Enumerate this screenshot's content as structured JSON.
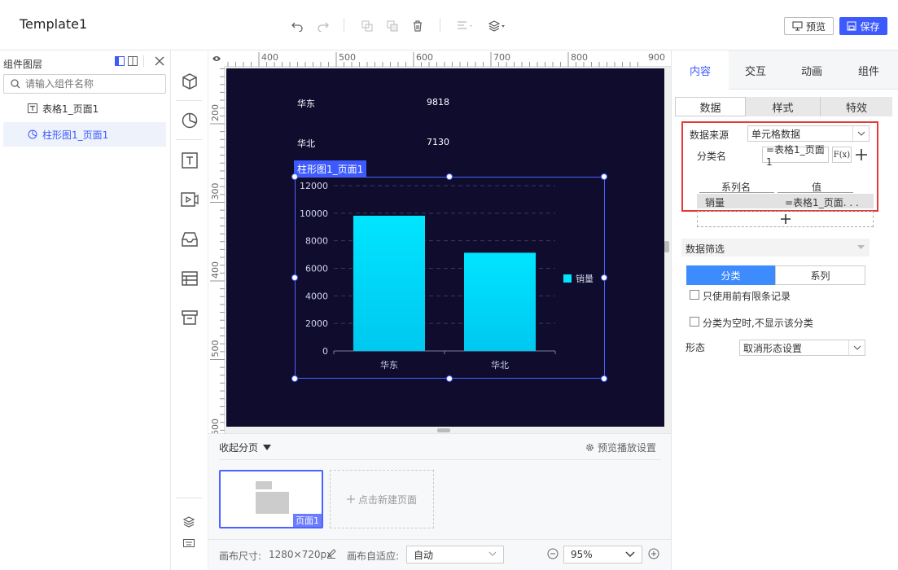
{
  "app": {
    "title": "Template1"
  },
  "toolbar": {
    "preview_label": "预览",
    "save_label": "保存",
    "accent": "#3d5afe"
  },
  "layers": {
    "title": "组件图层",
    "search_placeholder": "请输入组件名称",
    "items": [
      {
        "label": "表格1_页面1",
        "icon": "table-icon",
        "selected": false
      },
      {
        "label": "柱形图1_页面1",
        "icon": "pie-chart-icon",
        "selected": true
      }
    ]
  },
  "ruler": {
    "top_ticks": [
      "400",
      "500",
      "600",
      "700",
      "800",
      "900"
    ],
    "left_ticks": [
      "200",
      "300",
      "400",
      "500",
      "600"
    ]
  },
  "canvas": {
    "background": "#0f0c2e",
    "table_rows": [
      {
        "region": "华东",
        "value": "9818"
      },
      {
        "region": "华北",
        "value": "7130"
      }
    ],
    "chart_label": "柱形图1_页面1"
  },
  "chart_data": {
    "type": "bar",
    "categories": [
      "华东",
      "华北"
    ],
    "series": [
      {
        "name": "销量",
        "values": [
          9818,
          7130
        ]
      }
    ],
    "title": "",
    "xlabel": "",
    "ylabel": "",
    "ylim": [
      0,
      12000
    ],
    "yticks": [
      "0",
      "2000",
      "4000",
      "6000",
      "8000",
      "10000",
      "12000"
    ],
    "grid": true,
    "legend": "right",
    "bar_color": "#00e5ff"
  },
  "pages": {
    "collapse_label": "收起分页",
    "preview_settings_label": "预览播放设置",
    "thumb_label": "页面1",
    "new_page_label": "点击新建页面"
  },
  "bottom": {
    "canvas_size_label": "画布尺寸:",
    "canvas_size_value": "1280×720px",
    "adapt_label": "画布自适应:",
    "adapt_value": "自动",
    "zoom_value": "95%"
  },
  "right_panel": {
    "tabs": [
      "内容",
      "交互",
      "动画",
      "组件"
    ],
    "active_tab": "内容",
    "subtabs": [
      "数据",
      "样式",
      "特效"
    ],
    "data_source_label": "数据来源",
    "data_source_value": "单元格数据",
    "category_label": "分类名",
    "category_value": "=表格1_页面1",
    "fx_label": "F(x)",
    "series_header": "系列名",
    "value_header": "值",
    "series_name": "销量",
    "series_value": "=表格1_页面. . .",
    "filter_label": "数据筛选",
    "filter_tabs": [
      "分类",
      "系列"
    ],
    "check_limit": "只使用前有限条记录",
    "check_empty": "分类为空时,不显示该分类",
    "form_label": "形态",
    "form_value": "取消形态设置"
  }
}
